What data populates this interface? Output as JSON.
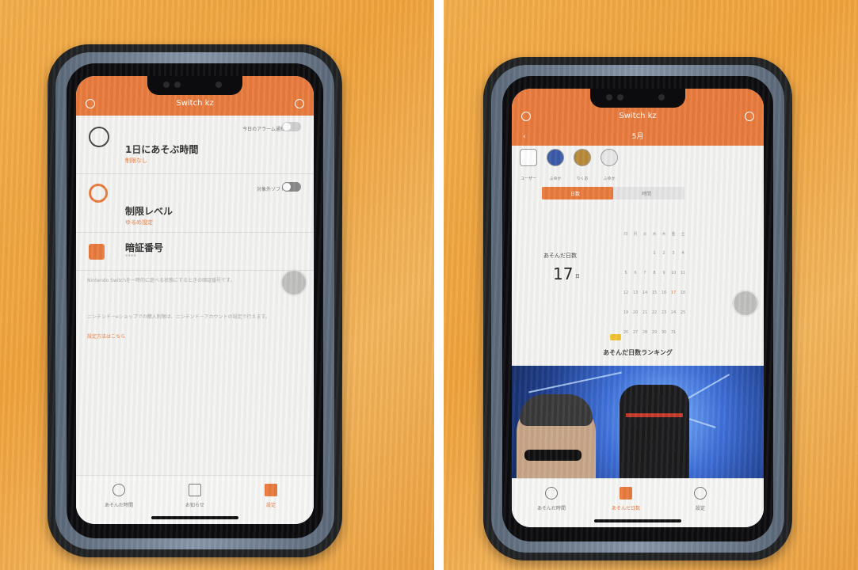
{
  "left_phone": {
    "header_title": "Switch kz",
    "rows": [
      {
        "title": "1日にあそぶ時間",
        "sub": "制限なし",
        "hint": "今日のアラーム通知"
      },
      {
        "title": "制限レベル",
        "sub": "ゆるめ設定",
        "hint": "対象外ソフト"
      },
      {
        "title": "暗証番号",
        "sub": "****",
        "hint": ""
      }
    ],
    "note1": "Nintendo Switchを一時的に遊べる状態にするときの暗証番号です。",
    "note2": "ニンテンドーeショップでの購入制限は、ニンテンドーアカウントの設定で行えます。",
    "note_link": "設定方法はこちら",
    "tabs": [
      {
        "label": "あそんだ時間",
        "active": false
      },
      {
        "label": "お知らせ",
        "active": false
      },
      {
        "label": "設定",
        "active": true
      }
    ]
  },
  "right_phone": {
    "header_title": "Switch kz",
    "month": "5月",
    "users": [
      "ユーザー",
      "ふゆか",
      "りくお",
      "ふゆか"
    ],
    "segment": [
      "日数",
      "時間"
    ],
    "play_days_label": "あそんだ日数",
    "play_days_value": "17",
    "play_days_unit": "日",
    "calendar": [
      "日",
      "月",
      "火",
      "水",
      "木",
      "金",
      "土",
      "",
      "",
      "",
      "1",
      "2",
      "3",
      "4",
      "5",
      "6",
      "7",
      "8",
      "9",
      "10",
      "11",
      "12",
      "13",
      "14",
      "15",
      "16",
      "17",
      "18",
      "19",
      "20",
      "21",
      "22",
      "23",
      "24",
      "25",
      "26",
      "27",
      "28",
      "29",
      "30",
      "31"
    ],
    "ranking_label": "あそんだ日数ランキング",
    "tabs": [
      {
        "label": "あそんだ時間",
        "active": false
      },
      {
        "label": "あそんだ日数",
        "active": true
      },
      {
        "label": "設定",
        "active": false
      }
    ]
  },
  "colors": {
    "accent": "#e97b3e",
    "table": "#efa23c"
  }
}
